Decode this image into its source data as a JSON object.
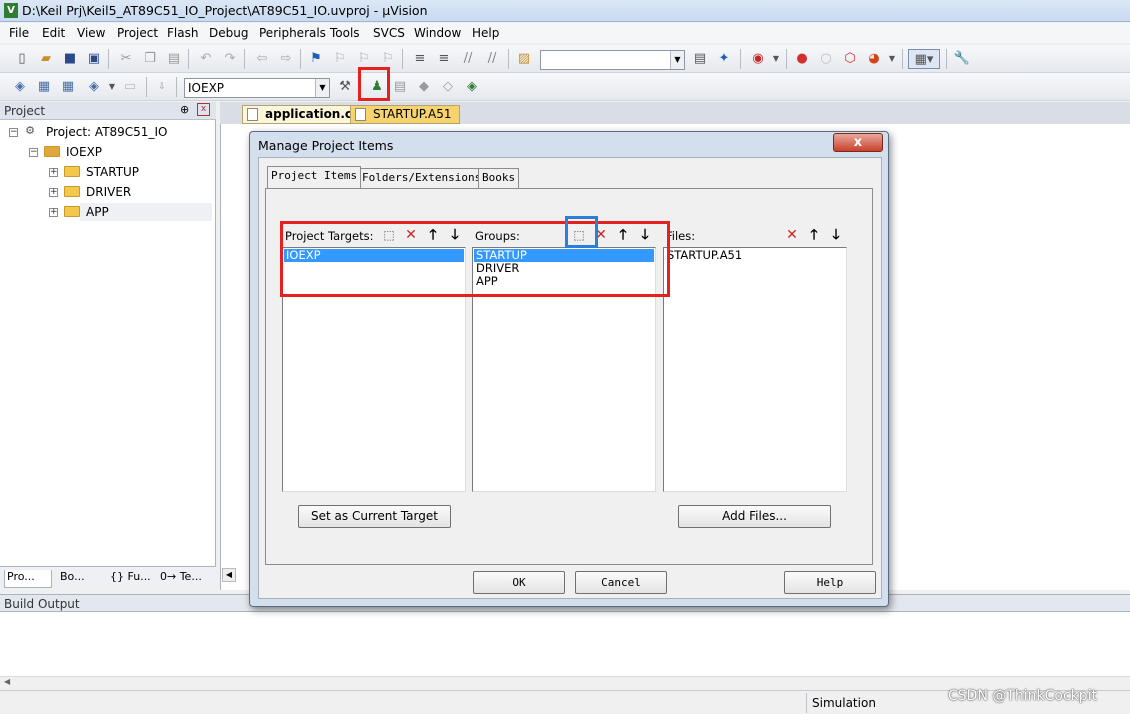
{
  "window": {
    "title": "D:\\Keil Prj\\Keil5_AT89C51_IO_Project\\AT89C51_IO.uvproj - µVision",
    "app_icon": "V"
  },
  "menu": [
    "File",
    "Edit",
    "View",
    "Project",
    "Flash",
    "Debug",
    "Peripherals",
    "Tools",
    "SVCS",
    "Window",
    "Help"
  ],
  "toolbar": {
    "target_select": "IOEXP",
    "find_box": ""
  },
  "project_pane": {
    "title": "Project",
    "root": "Project: AT89C51_IO",
    "target": "IOEXP",
    "groups": [
      "STARTUP",
      "DRIVER",
      "APP"
    ],
    "tabs": [
      "Pro...",
      "Bo...",
      "{} Fu...",
      "0→ Te..."
    ]
  },
  "editor_tabs": [
    "application.c",
    "STARTUP.A51"
  ],
  "build_output": {
    "title": "Build Output"
  },
  "status": {
    "mode": "Simulation"
  },
  "watermark": "CSDN @ThinkCockpit",
  "dialog": {
    "title": "Manage Project Items",
    "close_label": "x",
    "tabs": [
      "Project Items",
      "Folders/Extensions",
      "Books"
    ],
    "targets_label": "Project Targets:",
    "targets": [
      "IOEXP"
    ],
    "groups_label": "Groups:",
    "groups": [
      "STARTUP",
      "DRIVER",
      "APP"
    ],
    "files_label": "Files:",
    "files": [
      "STARTUP.A51"
    ],
    "set_current_label": "Set as Current Target",
    "add_files_label": "Add Files...",
    "ok_label": "OK",
    "cancel_label": "Cancel",
    "help_label": "Help"
  },
  "colors": {
    "highlight": "#e5211f",
    "selection": "#3399ff",
    "blue_marker": "#2b7fd9"
  }
}
